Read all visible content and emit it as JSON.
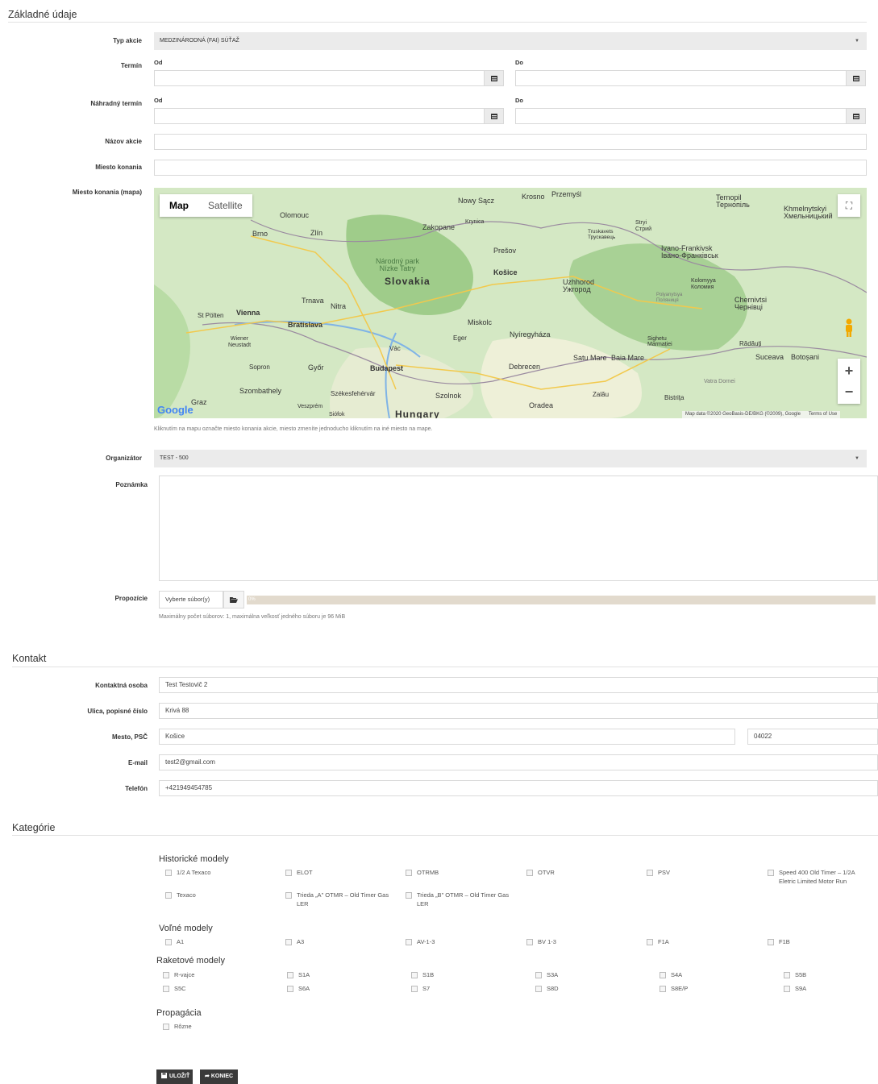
{
  "basic": {
    "title": "Základné údaje",
    "event_type_label": "Typ akcie",
    "event_type_value": "MEDZINÁRODNÁ (FAI) SÚŤAŽ",
    "term_label": "Termín",
    "from_label": "Od",
    "to_label": "Do",
    "alt_term_label": "Náhradný termín",
    "event_name_label": "Názov akcie",
    "venue_label": "Miesto konania",
    "venue_map_label": "Miesto konania (mapa)",
    "map_help": "Kliknutím na mapu označte miesto konania akcie, miesto zmeníte jednoducho kliknutím na iné miesto na mape.",
    "organizer_label": "Organizátor",
    "organizer_value": "TEST - 500",
    "note_label": "Poznámka",
    "props_label": "Propozície",
    "file_button": "Vyberte súbor(y)",
    "progress": "0%",
    "file_help": "Maximálny počet súborov: 1, maximálna veľkosť jedného súboru je 96 MiB"
  },
  "map": {
    "map_tab": "Map",
    "satellite_tab": "Satellite",
    "attribution": "Map data ©2020 GeoBasis-DE/BKG (©2009), Google",
    "terms": "Terms of Use",
    "google": "Google",
    "cities": [
      {
        "name": "Olomouc",
        "cls": ""
      },
      {
        "name": "Brno",
        "cls": ""
      },
      {
        "name": "Zlín",
        "cls": ""
      },
      {
        "name": "Nowy Sącz",
        "cls": ""
      },
      {
        "name": "Krosno",
        "cls": ""
      },
      {
        "name": "Przemyśl",
        "cls": ""
      },
      {
        "name": "Ternopil\nТернопіль",
        "cls": ""
      },
      {
        "name": "Khmelnytskyi\nХмельницький",
        "cls": ""
      },
      {
        "name": "Zakopane",
        "cls": ""
      },
      {
        "name": "Krynica",
        "cls": ""
      },
      {
        "name": "Truskavets\nТрускавець",
        "cls": ""
      },
      {
        "name": "Stryi\nСтрий",
        "cls": ""
      },
      {
        "name": "Prešov",
        "cls": ""
      },
      {
        "name": "Ivano-Frankivsk\nІвано-Франківськ",
        "cls": ""
      },
      {
        "name": "Národný park\nNízke Tatry",
        "cls": ""
      },
      {
        "name": "Slovakia",
        "cls": "big"
      },
      {
        "name": "Košice",
        "cls": ""
      },
      {
        "name": "Uzhhorod\nУжгород",
        "cls": ""
      },
      {
        "name": "Kolomyya\nКоломия",
        "cls": ""
      },
      {
        "name": "Polyanytsya\nПоляниця",
        "cls": ""
      },
      {
        "name": "Chernivtsi\nЧернівці",
        "cls": ""
      },
      {
        "name": "Trnava",
        "cls": ""
      },
      {
        "name": "Nitra",
        "cls": ""
      },
      {
        "name": "St Pölten",
        "cls": ""
      },
      {
        "name": "Vienna",
        "cls": ""
      },
      {
        "name": "Bratislava",
        "cls": ""
      },
      {
        "name": "Miskolc",
        "cls": ""
      },
      {
        "name": "Eger",
        "cls": ""
      },
      {
        "name": "Nyíregyháza",
        "cls": ""
      },
      {
        "name": "Sighetu\nMarmației",
        "cls": ""
      },
      {
        "name": "Rădăuți",
        "cls": ""
      },
      {
        "name": "Wiener\nNeustadt",
        "cls": ""
      },
      {
        "name": "Vác",
        "cls": ""
      },
      {
        "name": "Satu Mare",
        "cls": ""
      },
      {
        "name": "Baia Mare",
        "cls": ""
      },
      {
        "name": "Suceava",
        "cls": ""
      },
      {
        "name": "Botoșani",
        "cls": ""
      },
      {
        "name": "Sopron",
        "cls": ""
      },
      {
        "name": "Győr",
        "cls": ""
      },
      {
        "name": "Budapest",
        "cls": ""
      },
      {
        "name": "Debrecen",
        "cls": ""
      },
      {
        "name": "Vatra Dornei",
        "cls": ""
      },
      {
        "name": "Szombathely",
        "cls": ""
      },
      {
        "name": "Székesfehérvár",
        "cls": ""
      },
      {
        "name": "Szolnok",
        "cls": ""
      },
      {
        "name": "Zalău",
        "cls": ""
      },
      {
        "name": "Bistrița",
        "cls": ""
      },
      {
        "name": "Graz",
        "cls": ""
      },
      {
        "name": "Veszprém",
        "cls": ""
      },
      {
        "name": "Siófok",
        "cls": ""
      },
      {
        "name": "Hungary",
        "cls": "big"
      },
      {
        "name": "Oradea",
        "cls": ""
      }
    ]
  },
  "contact": {
    "title": "Kontakt",
    "person_label": "Kontaktná osoba",
    "person_value": "Test Testovič 2",
    "street_label": "Ulica, popisné číslo",
    "street_value": "Krivá 88",
    "city_label": "Mesto, PSČ",
    "city_value": "Košice",
    "zip_value": "04022",
    "email_label": "E-mail",
    "email_value": "test2@gmail.com",
    "phone_label": "Telefón",
    "phone_value": "+421949454785"
  },
  "categories": {
    "title": "Kategórie",
    "groups": [
      {
        "name": "Historické modely",
        "items": [
          "1/2 A Texaco",
          "ELOT",
          "OTRMB",
          "OTVR",
          "PSV",
          "Speed 400 Old Timer – 1/2A Eletric Limited Motor Run",
          "Texaco",
          "Trieda „A\" OTMR – Old Timer Gas LER",
          "Trieda „B\" OTMR – Old Timer Gas LER"
        ]
      },
      {
        "name": "Voľné modely",
        "items": [
          "A1",
          "A3",
          "AV-1-3",
          "BV 1-3",
          "F1A",
          "F1B"
        ]
      },
      {
        "name": "Raketové modely",
        "items": [
          "R-vajce",
          "S1A",
          "S1B",
          "S3A",
          "S4A",
          "S5B",
          "S5C",
          "S6A",
          "S7",
          "S8D",
          "S8E/P",
          "S9A"
        ]
      },
      {
        "name": "Propagácia",
        "items": [
          "Rôzne"
        ]
      }
    ]
  },
  "actions": {
    "save": "ULOŽIŤ",
    "end": "KONIEC"
  }
}
